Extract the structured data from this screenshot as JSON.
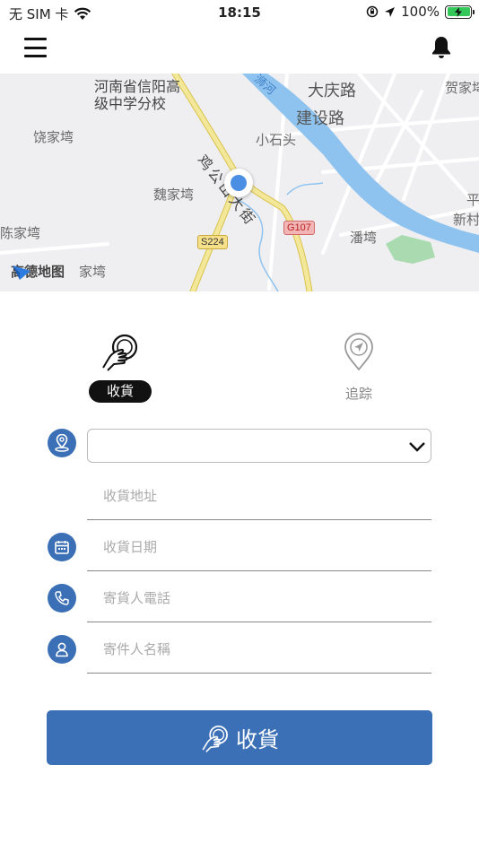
{
  "status_bar": {
    "carrier": "无 SIM 卡",
    "time": "18:15",
    "battery": "100%",
    "battery_level": 1.0
  },
  "map": {
    "labels": {
      "school": "河南省信阳高\n级中学分校",
      "daqing_road": "大庆路",
      "jianshe_road": "建设路",
      "river": "浉河",
      "hejiawan": "贺家塆",
      "raojiawan": "饶家塆",
      "xiaoshitou": "小石头",
      "street": "鸡公山大街",
      "weijiawan": "魏家塆",
      "chenjiawan": "陈家塆",
      "panwan": "潘塆",
      "pingxincun": "平\n新村",
      "lower_wan": "家塆"
    },
    "road_badges": {
      "s224": "S224",
      "g107": "G107"
    },
    "provider": "高德地图"
  },
  "tabs": {
    "receive": "收貨",
    "track": "追踪"
  },
  "form": {
    "select_value": "",
    "address_placeholder": "收貨地址",
    "date_placeholder": "收貨日期",
    "phone_placeholder": "寄貨人電話",
    "name_placeholder": "寄件人名稱"
  },
  "submit_label": "收貨",
  "colors": {
    "primary": "#3b70b7",
    "river": "#8fc3ef",
    "road": "#f3e79a",
    "battery": "#34c759"
  }
}
